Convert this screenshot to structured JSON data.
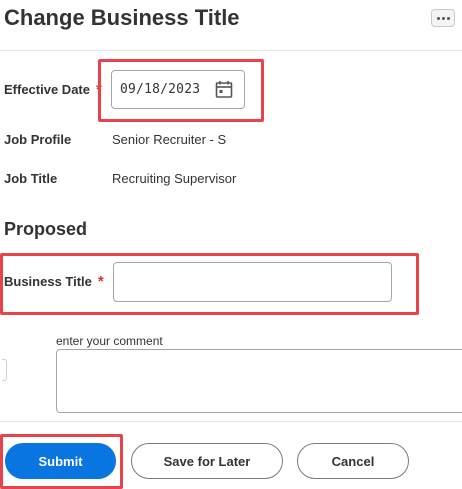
{
  "header": {
    "title": "Change Business Title",
    "more_icon": "more-horizontal-icon"
  },
  "fields": {
    "effective_date": {
      "label": "Effective Date",
      "required": "*",
      "value": "09/18/2023",
      "icon": "calendar-icon"
    },
    "job_profile": {
      "label": "Job Profile",
      "value": "Senior Recruiter - S"
    },
    "job_title": {
      "label": "Job Title",
      "value": "Recruiting Supervisor"
    }
  },
  "proposed": {
    "heading": "Proposed",
    "business_title": {
      "label": "Business Title",
      "required": "*",
      "value": ""
    }
  },
  "comment": {
    "label": "enter your comment",
    "value": ""
  },
  "actions": {
    "submit_label": "Submit",
    "save_label": "Save for Later",
    "cancel_label": "Cancel"
  },
  "colors": {
    "primary": "#0875e1",
    "required": "#de2e21",
    "highlight": "#e8424a",
    "text": "#333333"
  }
}
